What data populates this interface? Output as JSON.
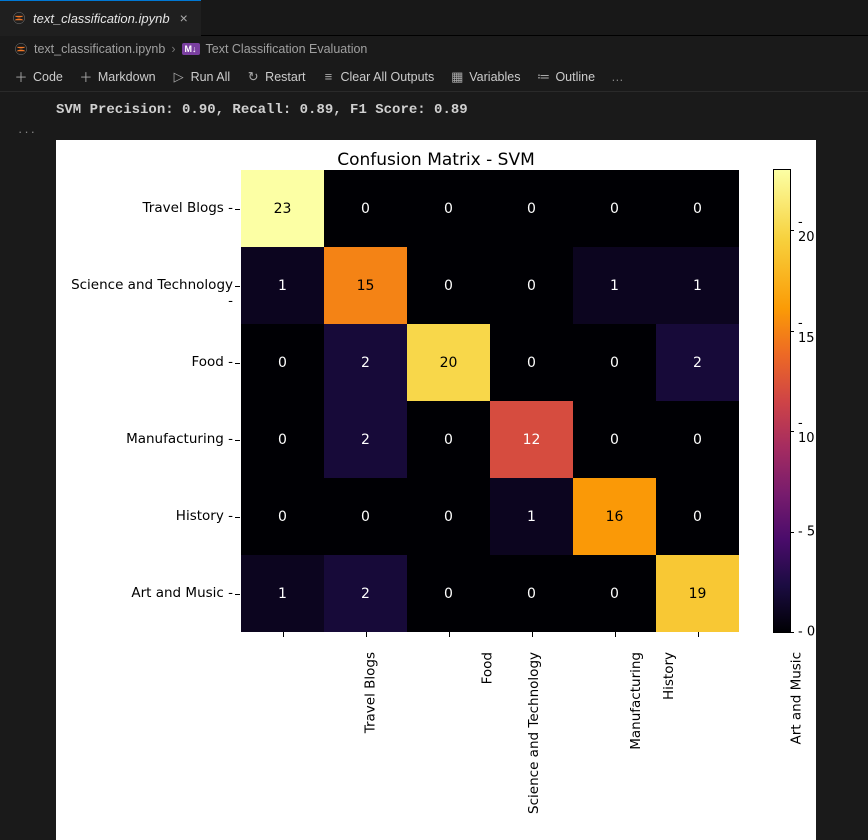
{
  "tab": {
    "title": "text_classification.ipynb"
  },
  "breadcrumb": {
    "file": "text_classification.ipynb",
    "cell": "Text Classification Evaluation"
  },
  "toolbar": {
    "code": "Code",
    "markdown": "Markdown",
    "runall": "Run All",
    "restart": "Restart",
    "clearout": "Clear All Outputs",
    "variables": "Variables",
    "outline": "Outline"
  },
  "output": {
    "stdout": "SVM Precision: 0.90, Recall: 0.89, F1 Score: 0.89"
  },
  "chart_data": {
    "type": "heatmap",
    "title": "Confusion Matrix - SVM",
    "xlabel": "",
    "ylabel": "",
    "categories": [
      "Travel Blogs",
      "Science and Technology",
      "Food",
      "Manufacturing",
      "History",
      "Art and Music"
    ],
    "matrix": [
      [
        23,
        0,
        0,
        0,
        0,
        0
      ],
      [
        1,
        15,
        0,
        0,
        1,
        1
      ],
      [
        0,
        2,
        20,
        0,
        0,
        2
      ],
      [
        0,
        2,
        0,
        12,
        0,
        0
      ],
      [
        0,
        0,
        0,
        1,
        16,
        0
      ],
      [
        1,
        2,
        0,
        0,
        0,
        19
      ]
    ],
    "cbar_ticks": [
      0,
      5,
      10,
      15,
      20
    ],
    "vmin": 0,
    "vmax": 23
  }
}
